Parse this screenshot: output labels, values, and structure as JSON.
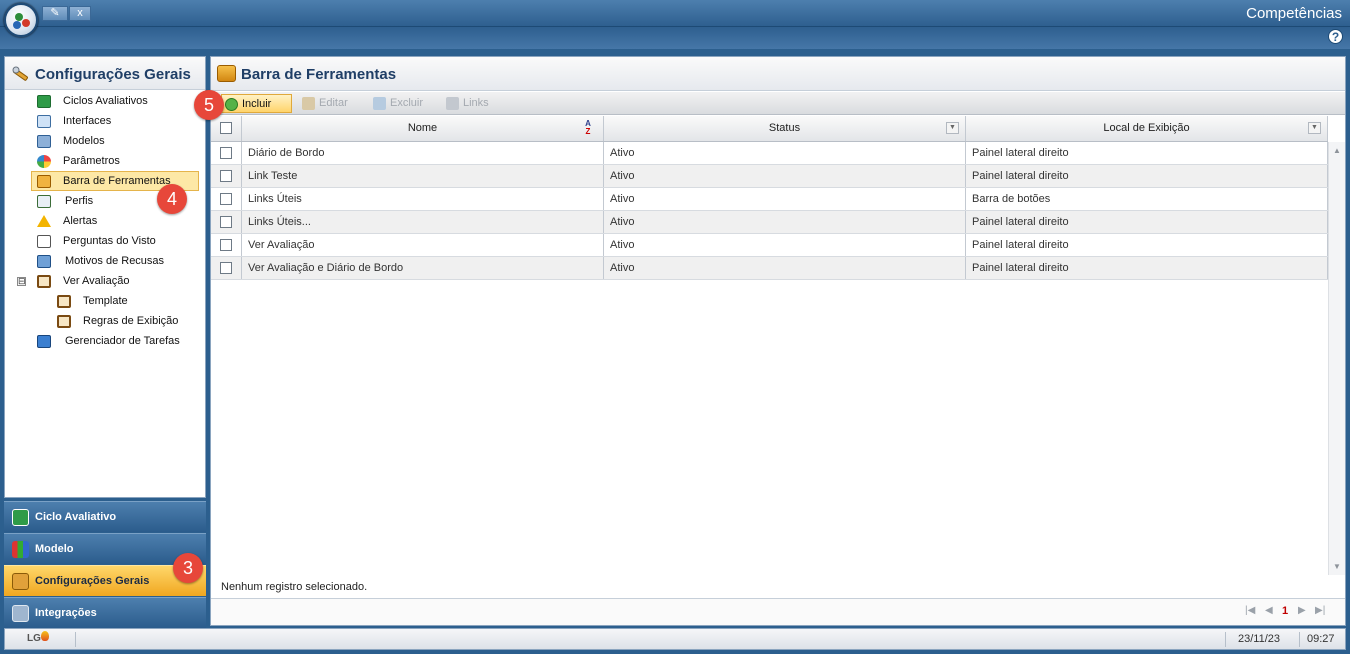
{
  "window": {
    "title": "Competências",
    "tab_close": "x"
  },
  "left_panel": {
    "title": "Configurações Gerais",
    "tree": [
      {
        "label": "Ciclos Avaliativos"
      },
      {
        "label": "Interfaces"
      },
      {
        "label": "Modelos"
      },
      {
        "label": "Parâmetros"
      },
      {
        "label": "Barra de Ferramentas",
        "selected": true
      },
      {
        "label": "Perfis"
      },
      {
        "label": "Alertas"
      },
      {
        "label": "Perguntas do Visto"
      },
      {
        "label": "Motivos de Recusas"
      },
      {
        "label": "Ver Avaliação",
        "expander": "⊟"
      },
      {
        "label": "Template"
      },
      {
        "label": "Regras de Exibição"
      },
      {
        "label": "Gerenciador de Tarefas"
      }
    ],
    "nav": [
      {
        "label": "Ciclo Avaliativo"
      },
      {
        "label": "Modelo"
      },
      {
        "label": "Configurações Gerais",
        "active": true
      },
      {
        "label": "Integrações"
      }
    ]
  },
  "main": {
    "title": "Barra de Ferramentas",
    "toolbar": {
      "include": "Incluir",
      "edit": "Editar",
      "delete": "Excluir",
      "links": "Links"
    },
    "columns": [
      "Nome",
      "Status",
      "Local de Exibição"
    ],
    "sort_glyph_top": "A",
    "sort_glyph_bottom": "Z",
    "rows": [
      [
        "Diário de Bordo",
        "Ativo",
        "Painel lateral direito"
      ],
      [
        "Link Teste",
        "Ativo",
        "Painel lateral direito"
      ],
      [
        "Links Úteis",
        "Ativo",
        "Barra de botões"
      ],
      [
        "Links Úteis...",
        "Ativo",
        "Painel lateral direito"
      ],
      [
        "Ver Avaliação",
        "Ativo",
        "Painel lateral direito"
      ],
      [
        "Ver Avaliação e Diário de Bordo",
        "Ativo",
        "Painel lateral direito"
      ]
    ],
    "selection_info": "Nenhum registro selecionado.",
    "pager": {
      "current_page": "1"
    }
  },
  "status_bar": {
    "logo": "LG",
    "date": "23/11/23",
    "time": "09:27"
  },
  "badges": {
    "b3": "3",
    "b4": "4",
    "b5": "5"
  },
  "colors": {
    "accent": "#2e5f8f",
    "active_nav": "#f0a720",
    "badge": "#e7473a",
    "selection": "#fde8a6"
  }
}
